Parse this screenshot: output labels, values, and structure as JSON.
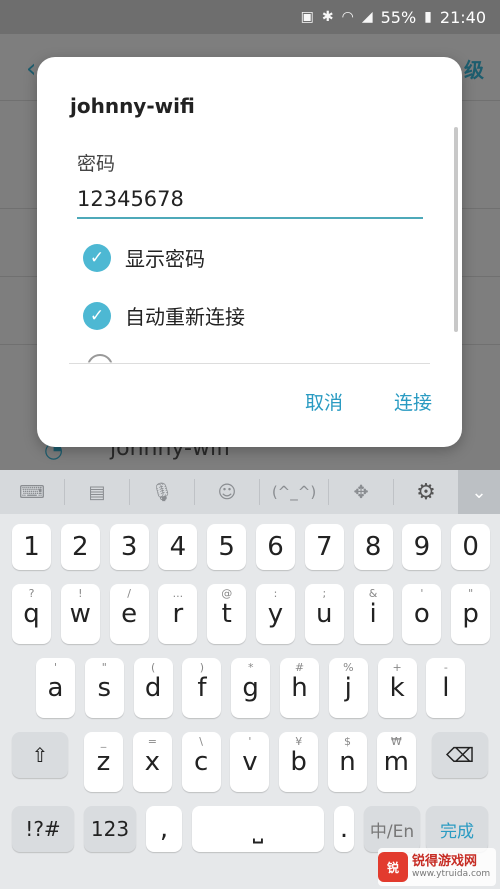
{
  "status_bar": {
    "battery": "55%",
    "time": "21:40"
  },
  "background": {
    "partial_title": "级",
    "network_name": "johnny-wifi"
  },
  "dialog": {
    "title": "johnny-wifi",
    "password_label": "密码",
    "password_value": "12345678",
    "show_password_label": "显示密码",
    "auto_reconnect_label": "自动重新连接",
    "cancel_label": "取消",
    "connect_label": "连接"
  },
  "keyboard_toolbar": {
    "emoticon": "(^_^)"
  },
  "keyboard": {
    "number_row": [
      "1",
      "2",
      "3",
      "4",
      "5",
      "6",
      "7",
      "8",
      "9",
      "0"
    ],
    "row1": [
      {
        "k": "q",
        "h": "?"
      },
      {
        "k": "w",
        "h": "!"
      },
      {
        "k": "e",
        "h": "/"
      },
      {
        "k": "r",
        "h": "..."
      },
      {
        "k": "t",
        "h": "@"
      },
      {
        "k": "y",
        "h": ":"
      },
      {
        "k": "u",
        "h": ";"
      },
      {
        "k": "i",
        "h": "&"
      },
      {
        "k": "o",
        "h": "'"
      },
      {
        "k": "p",
        "h": "\""
      }
    ],
    "row2": [
      {
        "k": "a",
        "h": "'"
      },
      {
        "k": "s",
        "h": "\""
      },
      {
        "k": "d",
        "h": "("
      },
      {
        "k": "f",
        "h": ")"
      },
      {
        "k": "g",
        "h": "*"
      },
      {
        "k": "h",
        "h": "#"
      },
      {
        "k": "j",
        "h": "%"
      },
      {
        "k": "k",
        "h": "+"
      },
      {
        "k": "l",
        "h": "-"
      }
    ],
    "row3": [
      {
        "k": "z",
        "h": "_"
      },
      {
        "k": "x",
        "h": "="
      },
      {
        "k": "c",
        "h": "\\"
      },
      {
        "k": "v",
        "h": "'"
      },
      {
        "k": "b",
        "h": "¥"
      },
      {
        "k": "n",
        "h": "$"
      },
      {
        "k": "m",
        "h": "₩"
      }
    ],
    "symbols_label": "!?#",
    "numbers_label": "123",
    "comma": ",",
    "period": ".",
    "lang_label": "中/En",
    "done_label": "完成"
  },
  "watermark": {
    "name": "锐得游戏网",
    "url": "www.ytruida.com"
  },
  "colors": {
    "accent": "#4db8d3",
    "button_text": "#2a9bc2",
    "input_underline": "#4da9b9"
  }
}
